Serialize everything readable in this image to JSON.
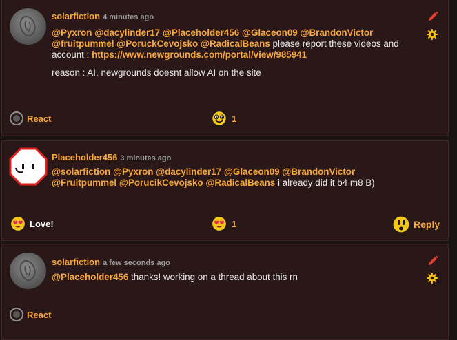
{
  "posts": [
    {
      "username": "solarfiction",
      "timestamp": "4 minutes ago",
      "mentions": [
        "@Pyxron",
        "@dacylinder17",
        "@Placeholder456",
        "@Glaceon09",
        "@BrandonVictor",
        "@fruitpummel",
        "@PoruckCevojsko",
        "@RadicalBeans"
      ],
      "text_after_mentions": "please report these videos and account :",
      "link": "https://www.newgrounds.com/portal/view/985941",
      "reason": "reason : AI. newgrounds doesnt allow AI on the site",
      "react_label": "React",
      "reaction_count": "1"
    },
    {
      "username": "Placeholder456",
      "timestamp": "3 minutes ago",
      "mentions": [
        "@solarfiction",
        "@Pyxron",
        "@dacylinder17",
        "@Glaceon09",
        "@BrandonVictor",
        "@Fruitpummel",
        "@PorucikCevojsko",
        "@RadicalBeans"
      ],
      "text_after_mentions": "i already did it b4 m8 B)",
      "react_label": "Love!",
      "reaction_count": "1",
      "reply_label": "Reply"
    },
    {
      "username": "solarfiction",
      "timestamp": "a few seconds ago",
      "mentions": [
        "@Placeholder456"
      ],
      "text_after_mentions": "thanks! working on a thread about this rn",
      "react_label": "React"
    }
  ],
  "colors": {
    "accent": "#f7a63a",
    "background": "#2a1717",
    "text": "#e8e8e8"
  }
}
